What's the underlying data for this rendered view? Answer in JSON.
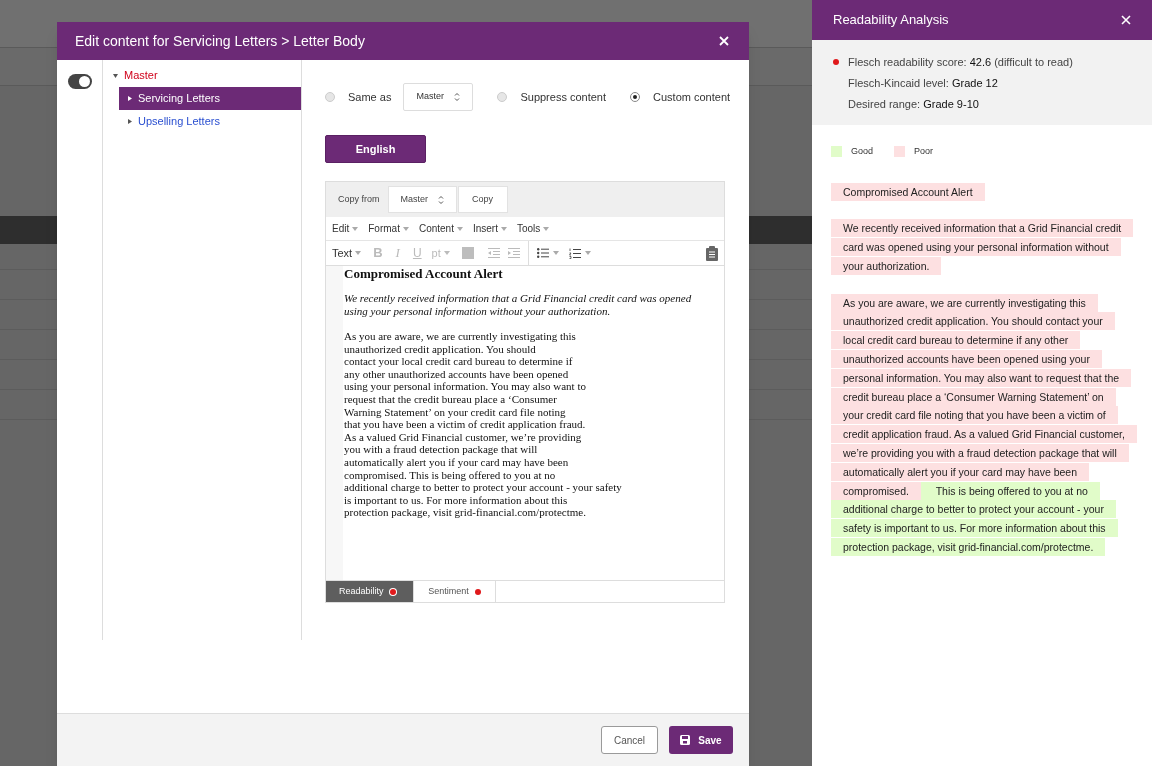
{
  "dialog": {
    "title": "Edit content for Servicing Letters > Letter Body",
    "toggle_on": true,
    "tree": [
      {
        "label": "Master",
        "expanded": true,
        "selected": false,
        "children": [
          {
            "label": "Servicing Letters",
            "expanded": false,
            "selected": true
          },
          {
            "label": "Upselling Letters",
            "expanded": false,
            "selected": false
          }
        ]
      }
    ],
    "options": [
      {
        "kind": "radio-select",
        "label": "Same as",
        "selected": false,
        "value": "Master"
      },
      {
        "kind": "radio",
        "label": "Suppress content",
        "selected": false
      },
      {
        "kind": "radio",
        "label": "Custom content",
        "selected": true
      }
    ],
    "language_button": "English",
    "editor": {
      "copy_from_label": "Copy from",
      "copy_from_value": "Master",
      "copy_button": "Copy",
      "menus": [
        "Edit",
        "Format",
        "Content",
        "Insert",
        "Tools"
      ],
      "format_tools": {
        "text": "Text",
        "bold": "B",
        "italic": "I",
        "underline": "U",
        "size": "pt"
      },
      "document": [
        {
          "kind": "heading",
          "lines": [
            "Compromised Account Alert"
          ]
        },
        {
          "kind": "italic",
          "lines": [
            "We recently received information that a Grid Financial credit card was opened",
            "using your personal information without your authorization."
          ]
        },
        {
          "kind": "plain",
          "lines": [
            "As you are aware, we are currently investigating this",
            "unauthorized credit application. You should",
            "contact your local credit card bureau to determine if",
            "any other unauthorized accounts have been opened",
            "using your personal information. You may also want to",
            "request that the credit bureau place a ‘Consumer",
            "Warning Statement’ on your credit card file noting",
            "that you have been a victim of credit application fraud.",
            "As a valued Grid Financial customer, we’re providing",
            "you with a fraud detection package that will",
            "automatically alert you if your card may have been",
            "compromised. This is being offered to you at no",
            "additional charge to better to protect your account - your safety",
            "is important to us. For more information about this",
            "protection package, visit grid-financial.com/protectme."
          ]
        }
      ],
      "tabs": [
        {
          "label": "Readability",
          "selected": true,
          "color": "#e0191b"
        },
        {
          "label": "Sentiment",
          "selected": false,
          "color": "#e0191b"
        }
      ]
    },
    "buttons": [
      {
        "kind": "secondary",
        "label": "Cancel"
      },
      {
        "kind": "primary",
        "label": "Save"
      }
    ]
  },
  "readability": {
    "title": "Readability Analysis",
    "metrics": [
      {
        "label": "Flesch readability score: ",
        "value": "42.6",
        "note": " (difficult to read)",
        "color": "#e0191b"
      },
      {
        "label": "Flesch-Kincaid level: ",
        "value": "Grade 12"
      },
      {
        "label": "Desired range: ",
        "value": "Grade 9-10"
      }
    ],
    "legend": [
      {
        "label": "Good",
        "color": "#e1fcc9"
      },
      {
        "label": "Poor",
        "color": "#fde0e1"
      }
    ],
    "blocks": [
      {
        "segments": [
          {
            "text": "Compromised Account Alert",
            "color": "#fde0e1"
          }
        ]
      },
      {
        "segments": [
          {
            "text": "We recently received information that a Grid Financial credit card was opened using your personal information without your authorization.",
            "color": "#fde0e1"
          }
        ]
      },
      {
        "segments": [
          {
            "text": "As you are aware, we are currently investigating this unauthorized credit application. You should contact your local credit card bureau to determine if any other unauthorized accounts have been opened using your personal information. You may also want to request that the credit bureau place a ‘Consumer Warning Statement’ on your credit card file noting that you have been a victim of credit application fraud. As a valued Grid Financial customer, we’re providing you with a fraud detection package that will automatically alert you if your card may have been compromised.",
            "color": "#fde0e1"
          },
          {
            "text": " This is being offered to you at no additional charge to better to protect your account - your safety is important to us. For more information about this protection package, visit grid-financial.com/protectme.",
            "color": "#e1fcc9"
          }
        ]
      }
    ]
  }
}
